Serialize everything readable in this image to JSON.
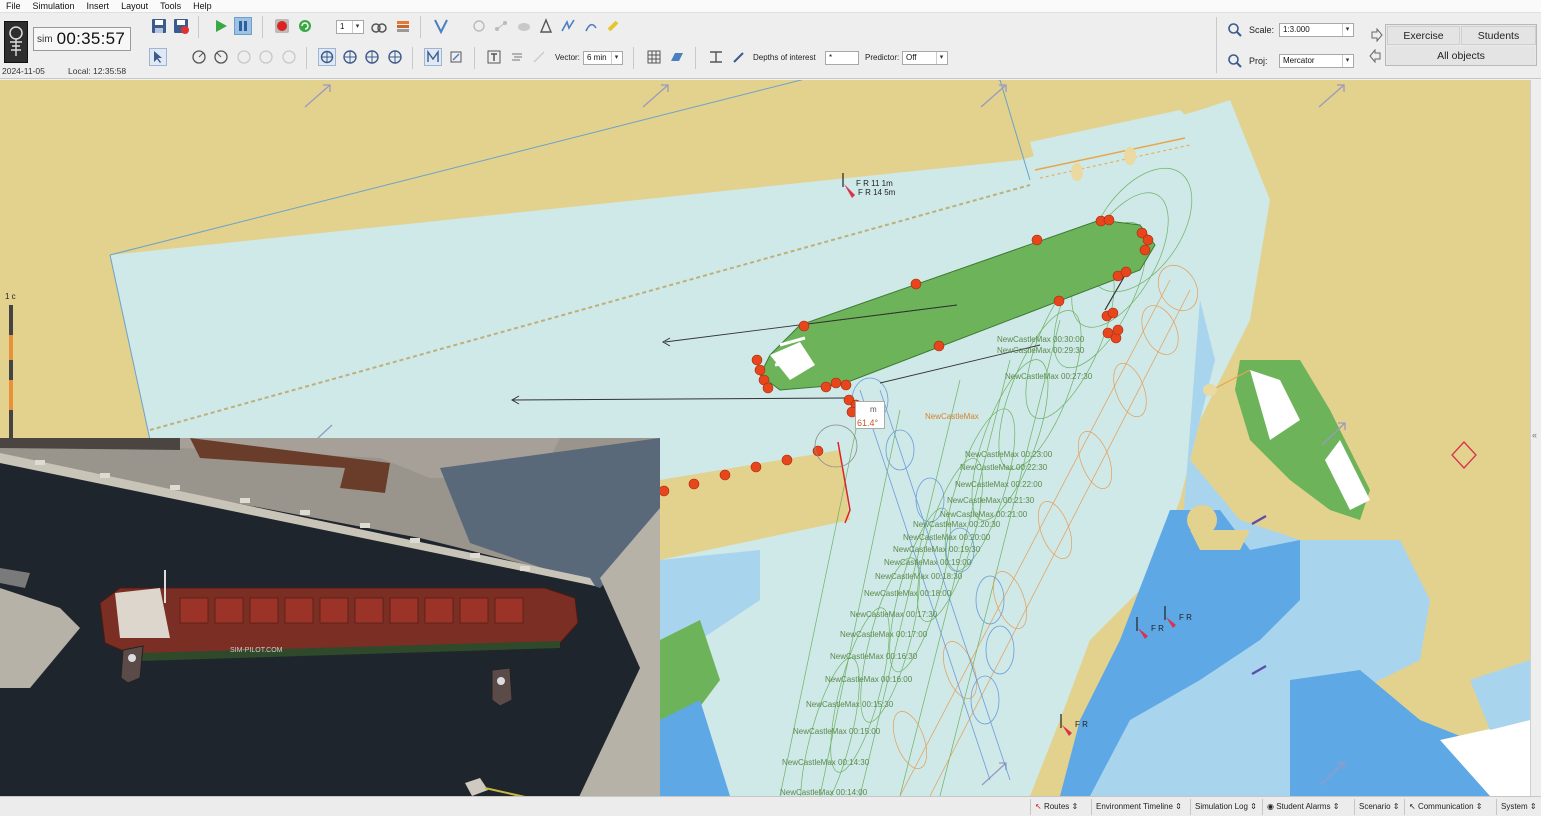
{
  "menu": [
    "File",
    "Simulation",
    "Insert",
    "Layout",
    "Tools",
    "Help"
  ],
  "sim": {
    "label": "sim",
    "clock": "00:35:57",
    "date": "2024-11-05",
    "local": "Local: 12:35:58"
  },
  "toolbar": {
    "speed_value": "1",
    "vector_label": "Vector:",
    "vector_value": "6 min",
    "depths_label": "Depths of interest",
    "depths_value": "*",
    "predictor_label": "Predictor:",
    "predictor_value": "Off",
    "scale_label": "Scale:",
    "scale_value": "1:3.000",
    "proj_label": "Proj:",
    "proj_value": "Mercator"
  },
  "tabs": {
    "exercise": "Exercise",
    "students": "Students",
    "all_objects": "All objects"
  },
  "map": {
    "depth_scale_label": "1 c",
    "light_labels": [
      "F R 11 1m",
      "F R 14 5m",
      "F R",
      "F R",
      "F R"
    ],
    "cursor_readout": "61.4°",
    "cursor_readout_unit": "m",
    "orange_track_label": "NewCastleMax",
    "green_track_labels": [
      "NewCastleMax 00:30:00",
      "NewCastleMax 00:29:30",
      "NewCastleMax 00:27:30",
      "NewCastleMax 00:23:00",
      "NewCastleMax 00:22:30",
      "NewCastleMax 00:22:00",
      "NewCastleMax 00:21:30",
      "NewCastleMax 00:21:00",
      "NewCastleMax 00:20:30",
      "NewCastleMax 00:20:00",
      "NewCastleMax 00:19:30",
      "NewCastleMax 00:19:00",
      "NewCastleMax 00:18:30",
      "NewCastleMax 00:18:00",
      "NewCastleMax 00:17:30",
      "NewCastleMax 00:17:00",
      "NewCastleMax 00:16:30",
      "NewCastleMax 00:16:00",
      "NewCastleMax 00:15:30",
      "NewCastleMax 00:15:00",
      "NewCastleMax 00:14:30",
      "NewCastleMax 00:14:00"
    ]
  },
  "view3d": {
    "hull_text": "SIM-PILOT.COM"
  },
  "statusbar": [
    "Routes",
    "Environment Timeline",
    "Simulation Log",
    "Student Alarms",
    "Scenario",
    "Communication",
    "System"
  ],
  "colors": {
    "land": "#e3d18e",
    "shallow_water": "#cfe8e8",
    "deep_water": "#5fa8e6",
    "mid_water": "#a8d4ee",
    "vessel_green": "#6db35a",
    "fender_orange": "#e8451c",
    "track_green": "#5eaa4e",
    "track_orange": "#e8913a",
    "track_blue": "#5b8fd8"
  }
}
